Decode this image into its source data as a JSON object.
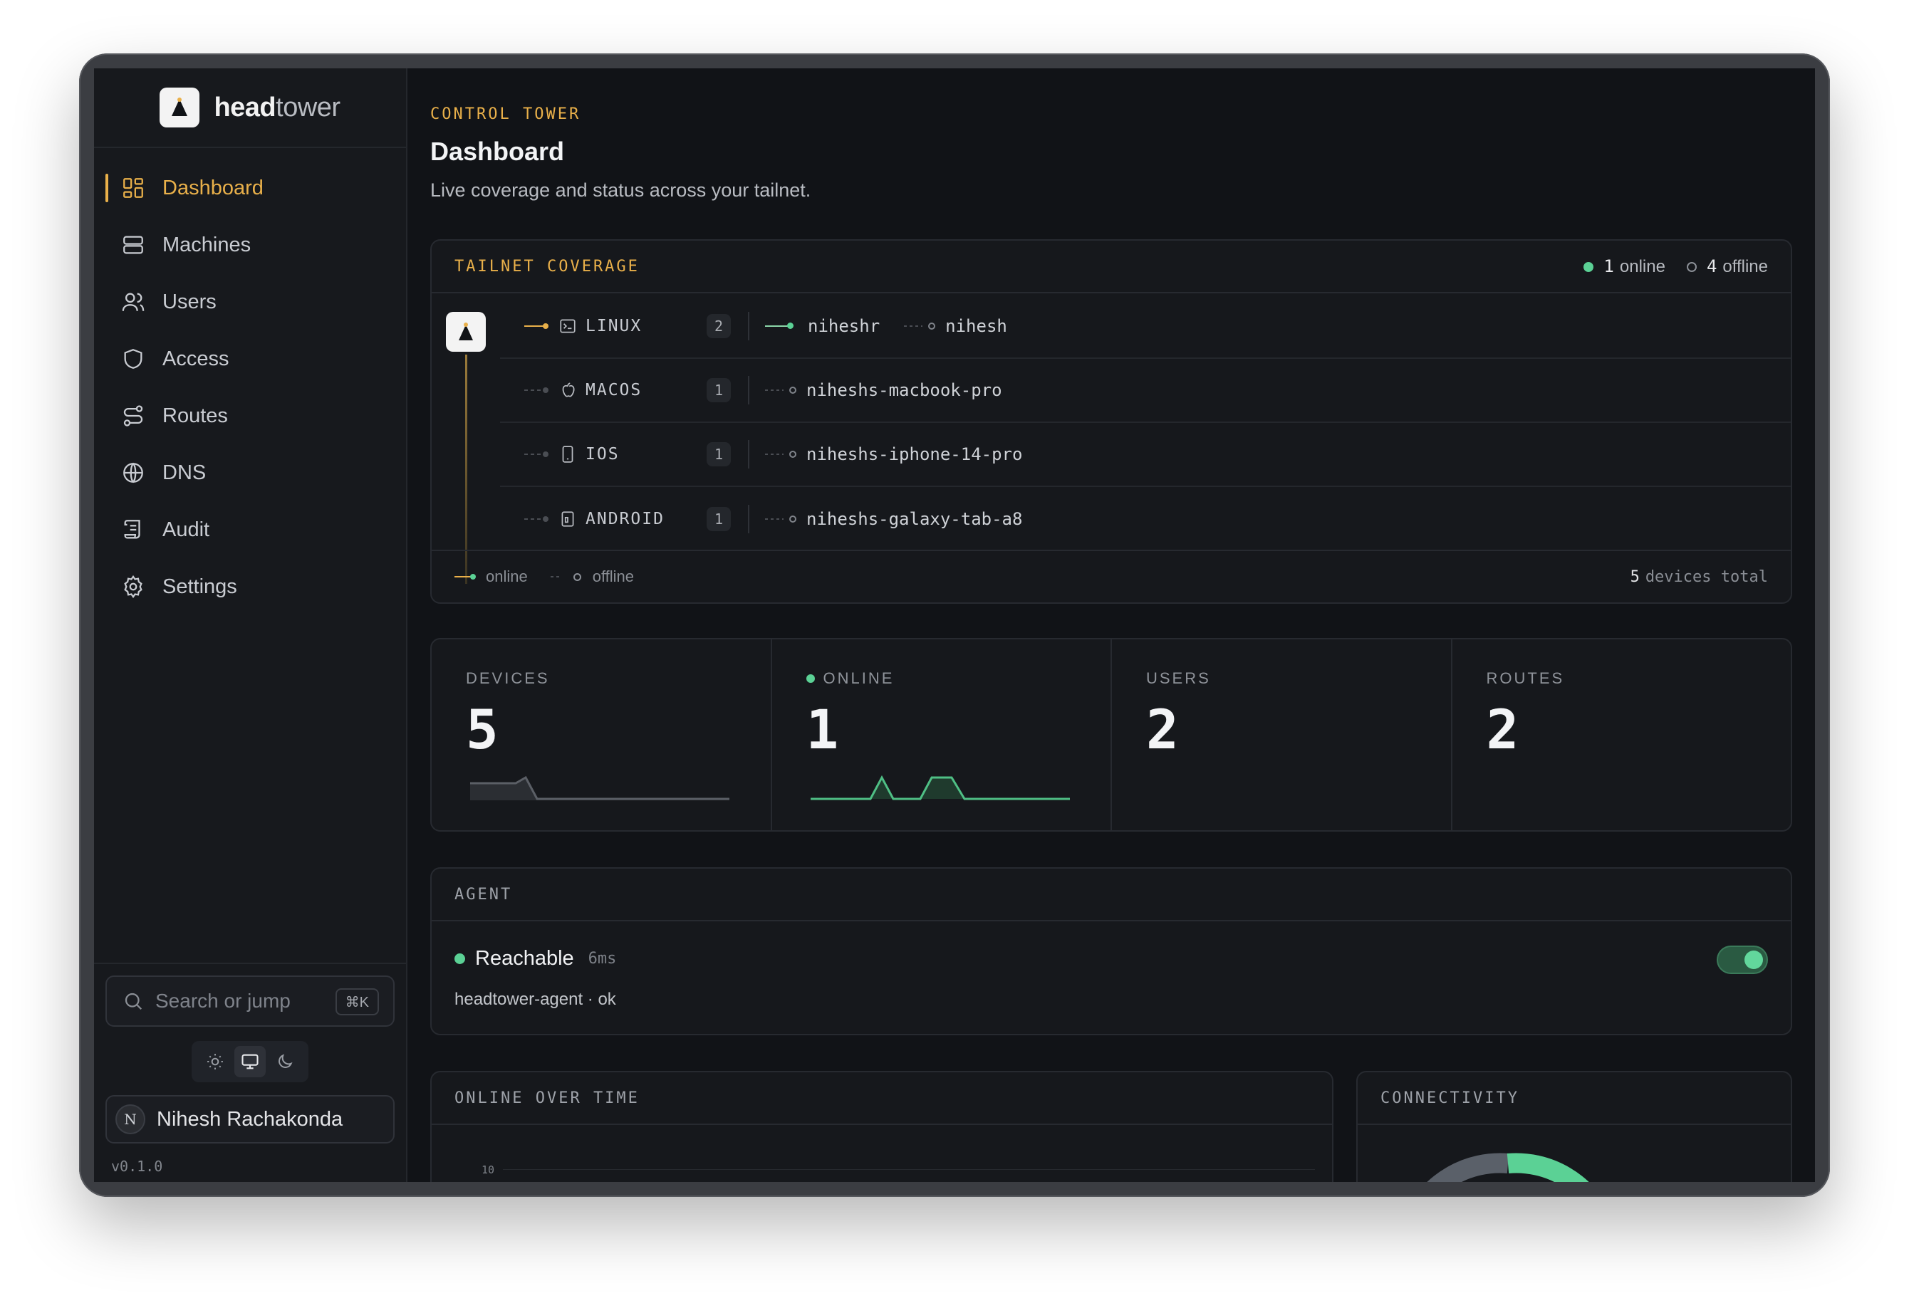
{
  "brand": {
    "name_bold": "head",
    "name_light": "tower"
  },
  "sidebar": {
    "items": [
      {
        "label": "Dashboard",
        "icon": "dashboard-icon",
        "active": true
      },
      {
        "label": "Machines",
        "icon": "server-icon"
      },
      {
        "label": "Users",
        "icon": "users-icon"
      },
      {
        "label": "Access",
        "icon": "shield-icon"
      },
      {
        "label": "Routes",
        "icon": "route-icon"
      },
      {
        "label": "DNS",
        "icon": "globe-icon"
      },
      {
        "label": "Audit",
        "icon": "scroll-icon"
      },
      {
        "label": "Settings",
        "icon": "gear-icon"
      }
    ],
    "search": {
      "placeholder": "Search or jump",
      "shortcut": "⌘K"
    },
    "theme_options": [
      "light",
      "system",
      "dark"
    ],
    "theme_selected": "system",
    "user": {
      "initials": "N",
      "name": "Nihesh Rachakonda"
    },
    "version": "v0.1.0"
  },
  "header": {
    "eyebrow": "CONTROL TOWER",
    "title": "Dashboard",
    "subtitle": "Live coverage and status across your tailnet."
  },
  "coverage": {
    "title": "TAILNET COVERAGE",
    "online_count": "1",
    "online_label": "online",
    "offline_count": "4",
    "offline_label": "offline",
    "rows": [
      {
        "os": "LINUX",
        "count": "2",
        "devices": [
          {
            "name": "niheshr",
            "online": true
          },
          {
            "name": "nihesh",
            "online": false
          }
        ]
      },
      {
        "os": "MACOS",
        "count": "1",
        "devices": [
          {
            "name": "niheshs-macbook-pro",
            "online": false
          }
        ]
      },
      {
        "os": "IOS",
        "count": "1",
        "devices": [
          {
            "name": "niheshs-iphone-14-pro",
            "online": false
          }
        ]
      },
      {
        "os": "ANDROID",
        "count": "1",
        "devices": [
          {
            "name": "niheshs-galaxy-tab-a8",
            "online": false
          }
        ]
      }
    ],
    "legend_online": "online",
    "legend_offline": "offline",
    "total_count": "5",
    "total_label": "devices total"
  },
  "stats": {
    "devices": {
      "label": "DEVICES",
      "value": "5"
    },
    "online": {
      "label": "ONLINE",
      "value": "1"
    },
    "users": {
      "label": "USERS",
      "value": "2"
    },
    "routes": {
      "label": "ROUTES",
      "value": "2"
    }
  },
  "agent": {
    "title": "AGENT",
    "status": "Reachable",
    "latency": "6ms",
    "detail": "headtower-agent · ok",
    "enabled": true
  },
  "online_over_time": {
    "title": "ONLINE OVER TIME",
    "y_tick": "10"
  },
  "connectivity": {
    "title": "CONNECTIVITY"
  },
  "colors": {
    "accent": "#e9b04a",
    "online": "#5bd195",
    "background": "#111317"
  }
}
